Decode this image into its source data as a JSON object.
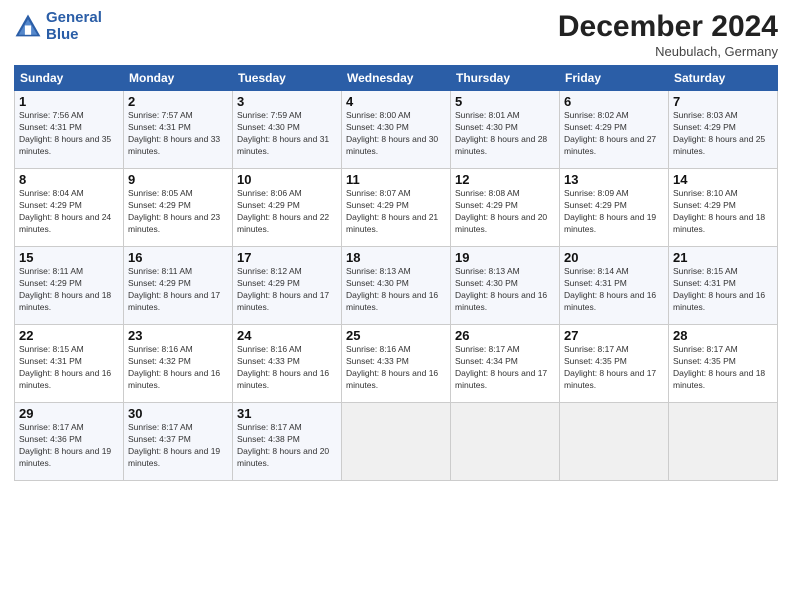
{
  "header": {
    "logo_line1": "General",
    "logo_line2": "Blue",
    "title": "December 2024",
    "subtitle": "Neubulach, Germany"
  },
  "days_of_week": [
    "Sunday",
    "Monday",
    "Tuesday",
    "Wednesday",
    "Thursday",
    "Friday",
    "Saturday"
  ],
  "weeks": [
    [
      {
        "num": "1",
        "sunrise": "Sunrise: 7:56 AM",
        "sunset": "Sunset: 4:31 PM",
        "daylight": "Daylight: 8 hours and 35 minutes."
      },
      {
        "num": "2",
        "sunrise": "Sunrise: 7:57 AM",
        "sunset": "Sunset: 4:31 PM",
        "daylight": "Daylight: 8 hours and 33 minutes."
      },
      {
        "num": "3",
        "sunrise": "Sunrise: 7:59 AM",
        "sunset": "Sunset: 4:30 PM",
        "daylight": "Daylight: 8 hours and 31 minutes."
      },
      {
        "num": "4",
        "sunrise": "Sunrise: 8:00 AM",
        "sunset": "Sunset: 4:30 PM",
        "daylight": "Daylight: 8 hours and 30 minutes."
      },
      {
        "num": "5",
        "sunrise": "Sunrise: 8:01 AM",
        "sunset": "Sunset: 4:30 PM",
        "daylight": "Daylight: 8 hours and 28 minutes."
      },
      {
        "num": "6",
        "sunrise": "Sunrise: 8:02 AM",
        "sunset": "Sunset: 4:29 PM",
        "daylight": "Daylight: 8 hours and 27 minutes."
      },
      {
        "num": "7",
        "sunrise": "Sunrise: 8:03 AM",
        "sunset": "Sunset: 4:29 PM",
        "daylight": "Daylight: 8 hours and 25 minutes."
      }
    ],
    [
      {
        "num": "8",
        "sunrise": "Sunrise: 8:04 AM",
        "sunset": "Sunset: 4:29 PM",
        "daylight": "Daylight: 8 hours and 24 minutes."
      },
      {
        "num": "9",
        "sunrise": "Sunrise: 8:05 AM",
        "sunset": "Sunset: 4:29 PM",
        "daylight": "Daylight: 8 hours and 23 minutes."
      },
      {
        "num": "10",
        "sunrise": "Sunrise: 8:06 AM",
        "sunset": "Sunset: 4:29 PM",
        "daylight": "Daylight: 8 hours and 22 minutes."
      },
      {
        "num": "11",
        "sunrise": "Sunrise: 8:07 AM",
        "sunset": "Sunset: 4:29 PM",
        "daylight": "Daylight: 8 hours and 21 minutes."
      },
      {
        "num": "12",
        "sunrise": "Sunrise: 8:08 AM",
        "sunset": "Sunset: 4:29 PM",
        "daylight": "Daylight: 8 hours and 20 minutes."
      },
      {
        "num": "13",
        "sunrise": "Sunrise: 8:09 AM",
        "sunset": "Sunset: 4:29 PM",
        "daylight": "Daylight: 8 hours and 19 minutes."
      },
      {
        "num": "14",
        "sunrise": "Sunrise: 8:10 AM",
        "sunset": "Sunset: 4:29 PM",
        "daylight": "Daylight: 8 hours and 18 minutes."
      }
    ],
    [
      {
        "num": "15",
        "sunrise": "Sunrise: 8:11 AM",
        "sunset": "Sunset: 4:29 PM",
        "daylight": "Daylight: 8 hours and 18 minutes."
      },
      {
        "num": "16",
        "sunrise": "Sunrise: 8:11 AM",
        "sunset": "Sunset: 4:29 PM",
        "daylight": "Daylight: 8 hours and 17 minutes."
      },
      {
        "num": "17",
        "sunrise": "Sunrise: 8:12 AM",
        "sunset": "Sunset: 4:29 PM",
        "daylight": "Daylight: 8 hours and 17 minutes."
      },
      {
        "num": "18",
        "sunrise": "Sunrise: 8:13 AM",
        "sunset": "Sunset: 4:30 PM",
        "daylight": "Daylight: 8 hours and 16 minutes."
      },
      {
        "num": "19",
        "sunrise": "Sunrise: 8:13 AM",
        "sunset": "Sunset: 4:30 PM",
        "daylight": "Daylight: 8 hours and 16 minutes."
      },
      {
        "num": "20",
        "sunrise": "Sunrise: 8:14 AM",
        "sunset": "Sunset: 4:31 PM",
        "daylight": "Daylight: 8 hours and 16 minutes."
      },
      {
        "num": "21",
        "sunrise": "Sunrise: 8:15 AM",
        "sunset": "Sunset: 4:31 PM",
        "daylight": "Daylight: 8 hours and 16 minutes."
      }
    ],
    [
      {
        "num": "22",
        "sunrise": "Sunrise: 8:15 AM",
        "sunset": "Sunset: 4:31 PM",
        "daylight": "Daylight: 8 hours and 16 minutes."
      },
      {
        "num": "23",
        "sunrise": "Sunrise: 8:16 AM",
        "sunset": "Sunset: 4:32 PM",
        "daylight": "Daylight: 8 hours and 16 minutes."
      },
      {
        "num": "24",
        "sunrise": "Sunrise: 8:16 AM",
        "sunset": "Sunset: 4:33 PM",
        "daylight": "Daylight: 8 hours and 16 minutes."
      },
      {
        "num": "25",
        "sunrise": "Sunrise: 8:16 AM",
        "sunset": "Sunset: 4:33 PM",
        "daylight": "Daylight: 8 hours and 16 minutes."
      },
      {
        "num": "26",
        "sunrise": "Sunrise: 8:17 AM",
        "sunset": "Sunset: 4:34 PM",
        "daylight": "Daylight: 8 hours and 17 minutes."
      },
      {
        "num": "27",
        "sunrise": "Sunrise: 8:17 AM",
        "sunset": "Sunset: 4:35 PM",
        "daylight": "Daylight: 8 hours and 17 minutes."
      },
      {
        "num": "28",
        "sunrise": "Sunrise: 8:17 AM",
        "sunset": "Sunset: 4:35 PM",
        "daylight": "Daylight: 8 hours and 18 minutes."
      }
    ],
    [
      {
        "num": "29",
        "sunrise": "Sunrise: 8:17 AM",
        "sunset": "Sunset: 4:36 PM",
        "daylight": "Daylight: 8 hours and 19 minutes."
      },
      {
        "num": "30",
        "sunrise": "Sunrise: 8:17 AM",
        "sunset": "Sunset: 4:37 PM",
        "daylight": "Daylight: 8 hours and 19 minutes."
      },
      {
        "num": "31",
        "sunrise": "Sunrise: 8:17 AM",
        "sunset": "Sunset: 4:38 PM",
        "daylight": "Daylight: 8 hours and 20 minutes."
      },
      null,
      null,
      null,
      null
    ]
  ]
}
